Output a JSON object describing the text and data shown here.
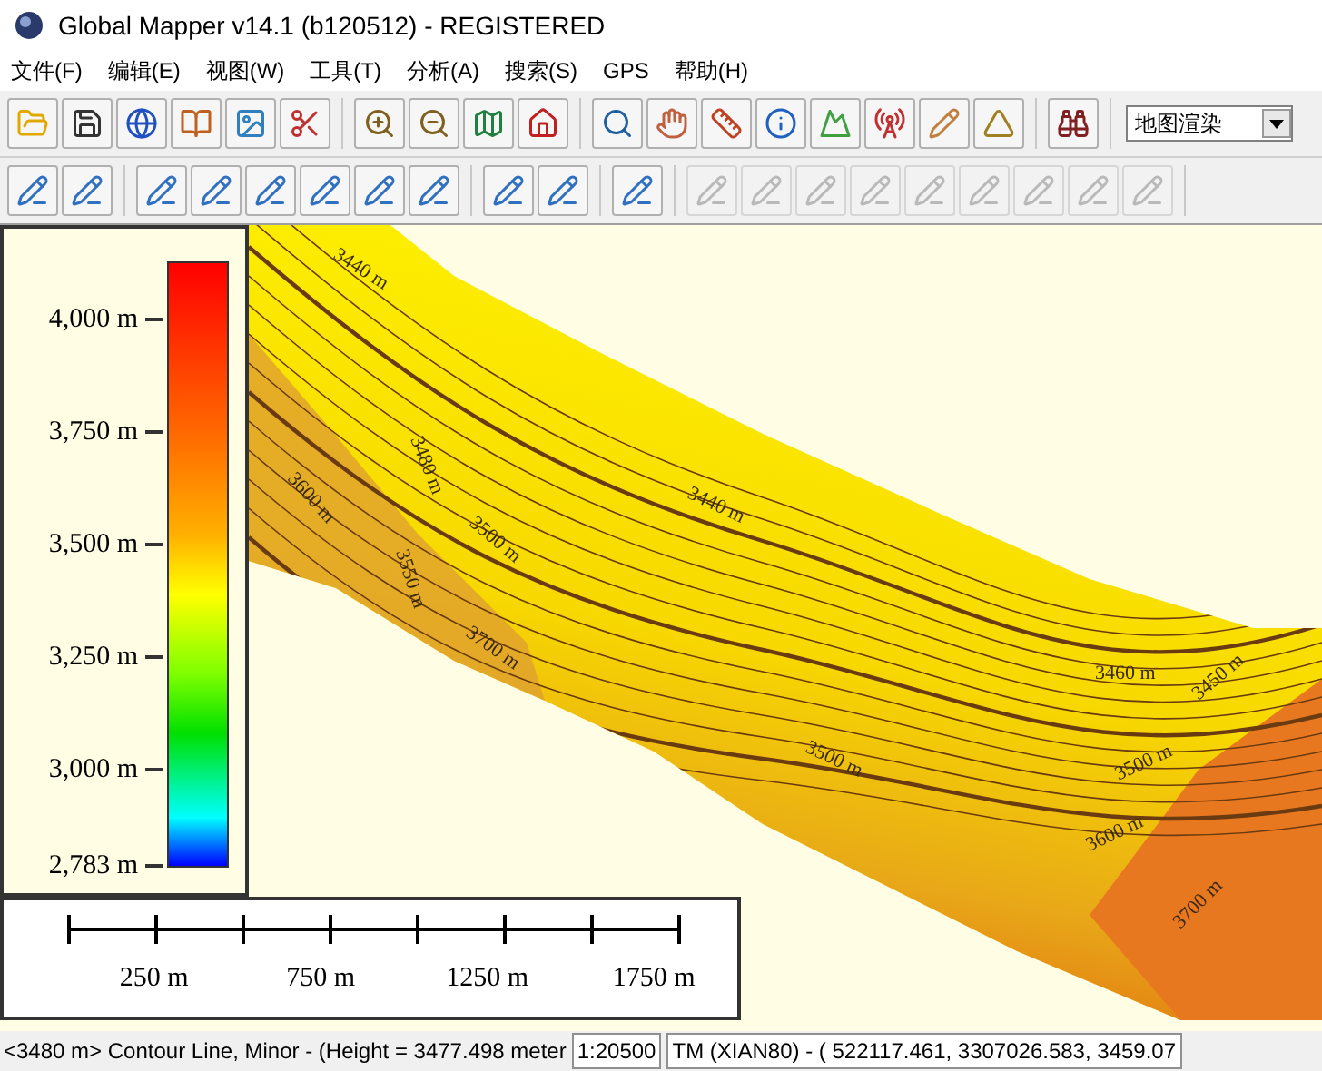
{
  "window": {
    "title": "Global Mapper v14.1 (b120512) - REGISTERED"
  },
  "menu": [
    "文件(F)",
    "编辑(E)",
    "视图(W)",
    "工具(T)",
    "分析(A)",
    "搜索(S)",
    "GPS",
    "帮助(H)"
  ],
  "toolbar_1": {
    "groups": [
      [
        {
          "disabled": false
        },
        {
          "disabled": false
        },
        {
          "disabled": false
        },
        {
          "disabled": false
        },
        {
          "disabled": false
        },
        {
          "disabled": false
        }
      ],
      [
        {
          "disabled": false
        },
        {
          "disabled": false
        },
        {
          "disabled": false
        },
        {
          "disabled": false
        }
      ],
      [
        {
          "disabled": false
        },
        {
          "disabled": false
        },
        {
          "disabled": false
        },
        {
          "disabled": false
        },
        {
          "disabled": false
        },
        {
          "disabled": false
        },
        {
          "disabled": false
        },
        {
          "disabled": false
        }
      ],
      [
        {
          "disabled": false
        }
      ]
    ],
    "dropdown": {
      "value": "地图渲染"
    }
  },
  "toolbar_2": {
    "groups": [
      [
        {
          "disabled": false
        },
        {
          "disabled": false
        }
      ],
      [
        {
          "disabled": false
        },
        {
          "disabled": false
        },
        {
          "disabled": false
        },
        {
          "disabled": false
        },
        {
          "disabled": false
        },
        {
          "disabled": false
        }
      ],
      [
        {
          "disabled": false
        },
        {
          "disabled": false
        }
      ],
      [
        {
          "disabled": false
        }
      ],
      [
        {
          "disabled": true
        },
        {
          "disabled": true
        },
        {
          "disabled": true
        },
        {
          "disabled": true
        },
        {
          "disabled": true
        },
        {
          "disabled": true
        },
        {
          "disabled": true
        },
        {
          "disabled": true
        },
        {
          "disabled": true
        }
      ]
    ]
  },
  "map": {
    "contour_labels": [
      "3440 m",
      "3600 m",
      "3480 m",
      "3500 m",
      "3550 m",
      "3700 m",
      "3440 m",
      "3500 m",
      "3460 m",
      "3450 m",
      "3500 m",
      "3600 m",
      "3700 m"
    ]
  },
  "legend": {
    "labels": [
      "4,000 m",
      "3,750 m",
      "3,500 m",
      "3,250 m",
      "3,000 m",
      "2,783 m"
    ]
  },
  "scale_bar": {
    "labels": [
      "250 m",
      "750 m",
      "1250 m",
      "1750 m"
    ]
  },
  "status_bar": {
    "feature": "<3480 m> Contour Line, Minor - (Height = 3477.498 meter",
    "scale": "1:20500",
    "coordinates": "TM (XIAN80) - ( 522117.461, 3307026.583, 3459.07"
  }
}
